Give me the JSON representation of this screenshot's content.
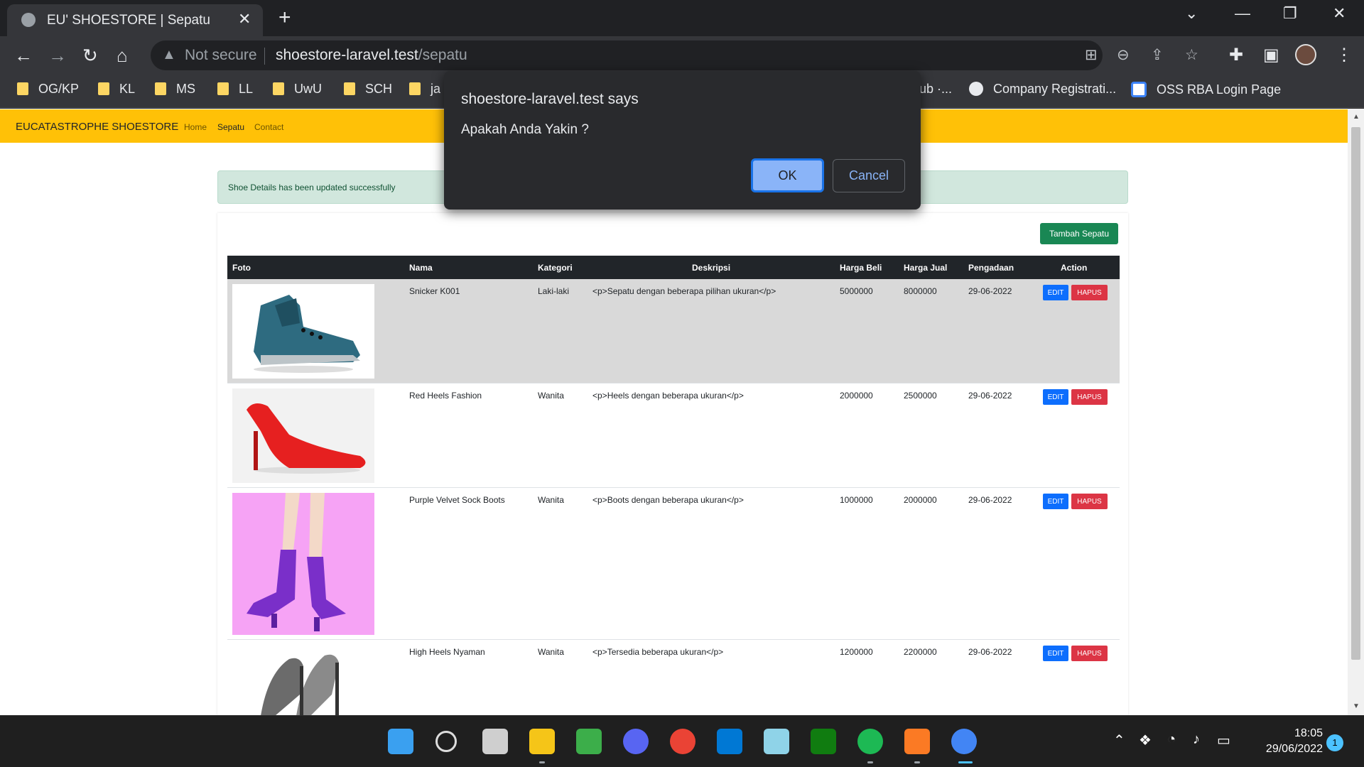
{
  "browser": {
    "tab_title": "EU' SHOESTORE | Sepatu",
    "close": "✕",
    "new_tab": "+",
    "security_label": "Not secure",
    "url_host": "shoestore-laravel.test",
    "url_path": "/sepatu",
    "bookmarks": [
      "OG/KP",
      "KL",
      "MS",
      "LL",
      "UwU",
      "SCH",
      "ja",
      "ub ·...",
      "Company Registrati...",
      "OSS RBA Login Page"
    ]
  },
  "site": {
    "brand": "EUCATASTROPHE SHOESTORE",
    "nav": [
      "Home",
      "Sepatu",
      "Contact"
    ],
    "active_nav": "Sepatu",
    "alert": "Shoe Details has been updated successfully",
    "add_button": "Tambah Sepatu",
    "table": {
      "headers": [
        "Foto",
        "Nama",
        "Kategori",
        "Deskripsi",
        "Harga Beli",
        "Harga Jual",
        "Pengadaan",
        "Action"
      ],
      "rows": [
        {
          "nama": "Snicker K001",
          "kategori": "Laki-laki",
          "deskripsi": "<p>Sepatu dengan beberapa pilihan ukuran</p>",
          "harga_beli": "5000000",
          "harga_jual": "8000000",
          "pengadaan": "29-06-2022",
          "photo_icon": "sneaker-photo"
        },
        {
          "nama": "Red Heels Fashion",
          "kategori": "Wanita",
          "deskripsi": "<p>Heels dengan beberapa ukuran</p>",
          "harga_beli": "2000000",
          "harga_jual": "2500000",
          "pengadaan": "29-06-2022",
          "photo_icon": "red-heel-photo"
        },
        {
          "nama": "Purple Velvet Sock Boots",
          "kategori": "Wanita",
          "deskripsi": "<p>Boots dengan beberapa ukuran</p>",
          "harga_beli": "1000000",
          "harga_jual": "2000000",
          "pengadaan": "29-06-2022",
          "photo_icon": "purple-boots-photo"
        },
        {
          "nama": "High Heels Nyaman",
          "kategori": "Wanita",
          "deskripsi": "<p>Tersedia beberapa ukuran</p>",
          "harga_beli": "1200000",
          "harga_jual": "2200000",
          "pengadaan": "29-06-2022",
          "photo_icon": "grey-heels-photo"
        }
      ],
      "edit_label": "EDIT",
      "delete_label": "HAPUS"
    }
  },
  "dialog": {
    "title": "shoestore-laravel.test says",
    "message": "Apakah Anda Yakin ?",
    "ok": "OK",
    "cancel": "Cancel"
  },
  "taskbar": {
    "time": "18:05",
    "date": "29/06/2022",
    "notifications": "1"
  },
  "colors": {
    "navbar": "#ffc107",
    "success_btn": "#198754",
    "edit_btn": "#0d6efd",
    "delete_btn": "#dc3545",
    "dialog_bg": "#292a2d"
  }
}
